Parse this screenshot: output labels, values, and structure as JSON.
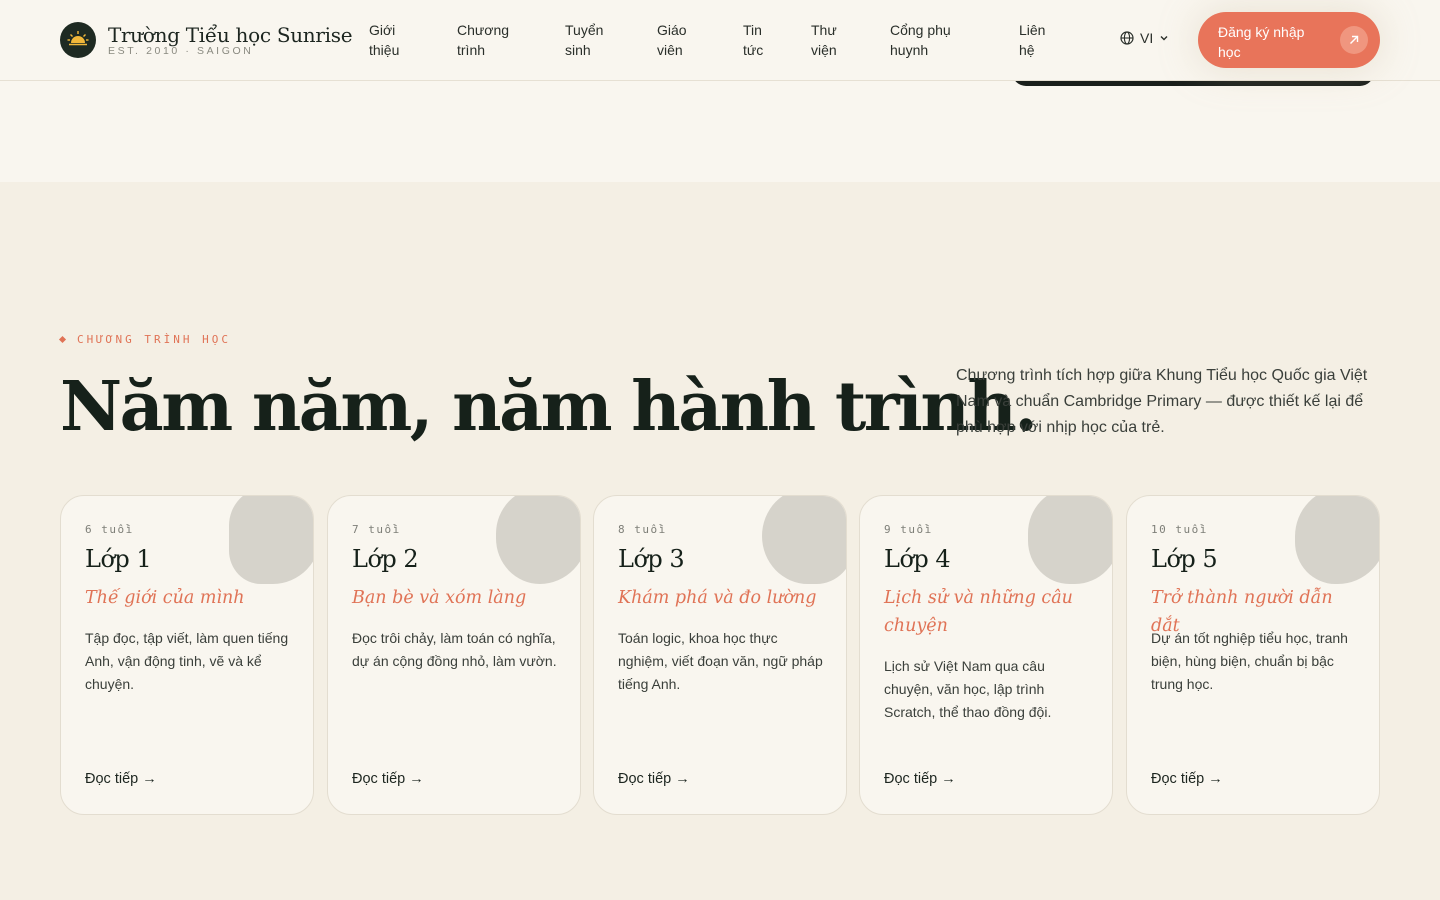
{
  "header": {
    "logo_title": "Trường Tiểu học Sunrise",
    "logo_sub": "EST. 2010 · SAIGON",
    "nav": [
      "Giới thiệu",
      "Chương trình",
      "Tuyển sinh",
      "Giáo viên",
      "Tin tức",
      "Thư viện",
      "Cổng phụ huynh",
      "Liên hệ"
    ],
    "lang": "VI",
    "cta": "Đăng ký nhập học"
  },
  "section": {
    "eyebrow": "CHƯƠNG TRÌNH HỌC",
    "heading": "Năm năm, năm hành trình.",
    "intro": "Chương trình tích hợp giữa Khung Tiểu học Quốc gia Việt Nam và chuẩn Cambridge Primary — được thiết kế lại để phù hợp với nhịp học của trẻ."
  },
  "cards": [
    {
      "age": "6 tuổi",
      "title": "Lớp 1",
      "subtitle": "Thế giới của mình",
      "desc": "Tập đọc, tập viết, làm quen tiếng Anh, vận động tinh, vẽ và kể chuyện.",
      "link": "Đọc tiếp →"
    },
    {
      "age": "7 tuổi",
      "title": "Lớp 2",
      "subtitle": "Bạn bè và xóm làng",
      "desc": "Đọc trôi chảy, làm toán có nghĩa, dự án cộng đồng nhỏ, làm vườn.",
      "link": "Đọc tiếp →"
    },
    {
      "age": "8 tuổi",
      "title": "Lớp 3",
      "subtitle": "Khám phá và đo lường",
      "desc": "Toán logic, khoa học thực nghiệm, viết đoạn văn, ngữ pháp tiếng Anh.",
      "link": "Đọc tiếp →"
    },
    {
      "age": "9 tuổi",
      "title": "Lớp 4",
      "subtitle": "Lịch sử và những câu chuyện",
      "desc": "Lịch sử Việt Nam qua câu chuyện, văn học, lập trình Scratch, thể thao đồng đội.",
      "link": "Đọc tiếp →"
    },
    {
      "age": "10 tuổi",
      "title": "Lớp 5",
      "subtitle": "Trở thành người dẫn dắt",
      "desc": "Dự án tốt nghiệp tiểu học, tranh biện, hùng biện, chuẩn bị bậc trung học.",
      "link": "Đọc tiếp →"
    }
  ],
  "colors": {
    "accent": "#e8745a",
    "dark": "#16211a",
    "background": "#f4efe4",
    "card": "#f9f6ef"
  }
}
